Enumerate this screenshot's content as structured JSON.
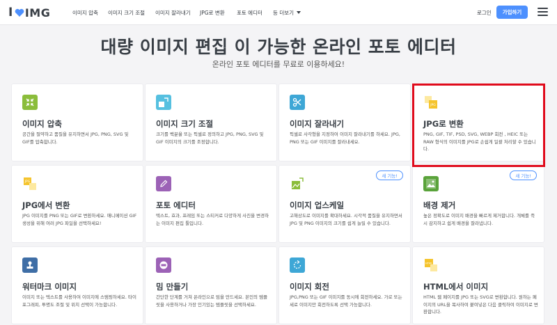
{
  "header": {
    "logo_text": "IMG",
    "logo_i": "I",
    "nav": [
      "이미지 압축",
      "이미지 크기 조절",
      "이미지 잘라내기",
      "JPG로 변환",
      "포토 에디터",
      "등 더보기"
    ],
    "login": "로그인",
    "signup": "가입하기"
  },
  "hero": {
    "title": "대량 이미지 편집 이 가능한 온라인 포토 에디터",
    "subtitle": "온라인 포토 에디터를 무료로 이용하세요!"
  },
  "cards": [
    {
      "title": "이미지 압축",
      "desc": "공간을 절약하고 품질을 유지하면서 JPG, PNG, SVG 및 GIF를 압축합니다.",
      "icon": "compress-icon",
      "color": "#8bbd3b"
    },
    {
      "title": "이미지 크기 조절",
      "desc": "크기를 백분율 또는 픽셀로 정의하고 JPG, PNG, SVG 및 GIF 이미지의 크기를 조정합니다.",
      "icon": "resize-icon",
      "color": "#56c0e0"
    },
    {
      "title": "이미지 잘라내기",
      "desc": "픽셀로 사각형을 지정하여 이미지 잘라내기를 하세요. JPG, PNG 또는 GIF 이미지를 잘라내세요.",
      "icon": "scissors-icon",
      "color": "#3ea7d6"
    },
    {
      "title": "JPG로 변환",
      "desc": "PNG, GIF, TIF, PSD, SVG, WEBP 회전 , HEIC 또는 RAW 형식의 이미지를 JPG로 손쉽게 일괄 처리할 수 있습니다.",
      "icon": "jpg-convert-icon",
      "color": "#f5c42d"
    },
    {
      "title": "JPG에서 변환",
      "desc": "JPG 이미지를 PNG 또는 GIF로 변환하세요. 애니메이션 GIF 생성을 위해 여러 JPG 파일을 선택하세요!",
      "icon": "jpg-from-icon",
      "color": "#f5c42d"
    },
    {
      "title": "포토 에디터",
      "desc": "텍스트, 효과, 프레임 또는 스티커로 다양하게 사진을 변경하는 이미지 편집 툴입니다.",
      "icon": "pencil-icon",
      "color": "#9c62b6"
    },
    {
      "title": "이미지 업스케일",
      "desc": "고해상도로 이미지를 확대하세요. 시각적 품질을 유지하면서 JPG 및 PNG 이미지의 크기를 쉽게 늘릴 수 있습니다.",
      "icon": "upscale-icon",
      "color": "#8bbd3b",
      "badge": "새 기능!"
    },
    {
      "title": "배경 제거",
      "desc": "높은 정확도로 이미지 배경을 빠르게 제거합니다. 개체를 즉시 감지하고 쉽게 배경을 잘라냅니다.",
      "icon": "remove-bg-icon",
      "color": "#5aa33a",
      "badge": "새 기능!"
    },
    {
      "title": "워터마크 이미지",
      "desc": "이미지 또는 텍스트를 사용하여 이미지에 스탬핑하세요. 타이포그래피, 투명도 조절 및 위치 선택이 가능합니다.",
      "icon": "stamp-icon",
      "color": "#3f6ea6"
    },
    {
      "title": "밈 만들기",
      "desc": "간단한 단계를 거쳐 온라인으로 밈을 만드세요. 본인의 템플릿을 사용하거나 가장 인기있는 템플릿을 선택하세요.",
      "icon": "meme-icon",
      "color": "#9c62b6"
    },
    {
      "title": "이미지 회전",
      "desc": "JPG,PNG 또는 GIF 이미지를 동시에 회전하세요. 가로 또는 세로 이미지만 회전하도록 선택 가능합니다.",
      "icon": "rotate-icon",
      "color": "#3ea7d6"
    },
    {
      "title": "HTML에서 이미지",
      "desc": "HTML 웹 페이지를 JPG 또는 SVG로 변환합니다. 원하는 페이지의 URL을 복사하여 붙여넣은 다음 클릭하여 이미지로 변환합니다.",
      "icon": "html-icon",
      "color": "#f5c42d"
    }
  ]
}
